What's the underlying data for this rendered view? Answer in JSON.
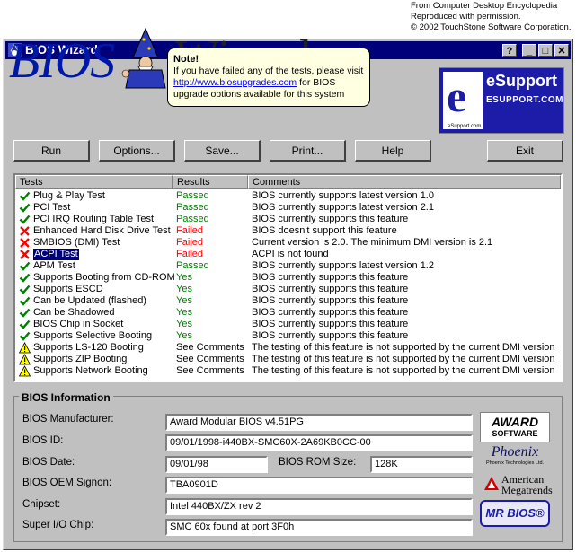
{
  "credit": {
    "line1": "From Computer Desktop Encyclopedia",
    "line2": "Reproduced with permission.",
    "line3": "© 2002 TouchStone Software Corporation."
  },
  "window": {
    "title": "BIOS Wizard",
    "help_btn": "?",
    "min_btn": "_",
    "max_btn": "□",
    "close_btn": "✕"
  },
  "banner": {
    "bios": "BIOS",
    "wizard": "Wizard"
  },
  "tooltip": {
    "note": "Note!",
    "line1": "If you have failed any of the tests, please visit",
    "link": "http://www.biosupgrades.com",
    "line2_rest": " for BIOS",
    "line3": "upgrade options available for this system"
  },
  "esupport": {
    "title": "eSupport",
    "sub": "ESUPPORT.COM",
    "small": "eSupport.com"
  },
  "buttons": {
    "run": "Run",
    "options": "Options...",
    "save": "Save...",
    "print": "Print...",
    "help": "Help",
    "exit": "Exit"
  },
  "table": {
    "headers": [
      "Tests",
      "Results",
      "Comments"
    ],
    "rows": [
      {
        "icon": "check",
        "test": "Plug & Play Test",
        "result": "Passed",
        "comment": "BIOS currently supports latest version 1.0"
      },
      {
        "icon": "check",
        "test": "PCI Test",
        "result": "Passed",
        "comment": "BIOS currently supports latest version 2.1"
      },
      {
        "icon": "check",
        "test": "PCI IRQ Routing Table Test",
        "result": "Passed",
        "comment": "BIOS currently supports this feature"
      },
      {
        "icon": "cross",
        "test": "Enhanced Hard Disk Drive Test",
        "result": "Failed",
        "comment": "BIOS doesn't support this feature"
      },
      {
        "icon": "cross",
        "test": "SMBIOS (DMI) Test",
        "result": "Failed",
        "comment": "Current version is 2.0. The minimum DMI version is 2.1"
      },
      {
        "icon": "cross",
        "test": "ACPI Test",
        "result": "Failed",
        "comment": "ACPI is not found"
      },
      {
        "icon": "check",
        "test": "APM Test",
        "result": "Passed",
        "comment": "BIOS currently supports latest version 1.2"
      },
      {
        "icon": "check",
        "test": "Supports Booting from CD-ROM",
        "result": "Yes",
        "comment": "BIOS currently supports this feature"
      },
      {
        "icon": "check",
        "test": "Supports ESCD",
        "result": "Yes",
        "comment": "BIOS currently supports this feature"
      },
      {
        "icon": "check",
        "test": "Can be Updated (flashed)",
        "result": "Yes",
        "comment": "BIOS currently supports this feature"
      },
      {
        "icon": "check",
        "test": "Can be Shadowed",
        "result": "Yes",
        "comment": "BIOS currently supports this feature"
      },
      {
        "icon": "check",
        "test": "BIOS Chip in Socket",
        "result": "Yes",
        "comment": "BIOS currently supports this feature"
      },
      {
        "icon": "check",
        "test": "Supports Selective Booting",
        "result": "Yes",
        "comment": "BIOS currently supports this feature"
      },
      {
        "icon": "warn",
        "test": "Supports LS-120 Booting",
        "result": "See Comments",
        "comment": "The testing of this feature is not supported by the current DMI version"
      },
      {
        "icon": "warn",
        "test": "Supports ZIP Booting",
        "result": "See Comments",
        "comment": "The testing of this feature is not supported by the current DMI version"
      },
      {
        "icon": "warn",
        "test": "Supports Network Booting",
        "result": "See Comments",
        "comment": "The testing of this feature is not supported by the current DMI version"
      }
    ]
  },
  "info": {
    "title": "BIOS Information",
    "manufacturer_label": "BIOS Manufacturer:",
    "manufacturer": "Award Modular BIOS v4.51PG",
    "id_label": "BIOS ID:",
    "id": "09/01/1998-i440BX-SMC60X-2A69KB0CC-00",
    "date_label": "BIOS Date:",
    "date": "09/01/98",
    "romsize_label": "BIOS ROM Size:",
    "romsize": "128K",
    "oem_label": "BIOS OEM Signon:",
    "oem": "TBA0901D",
    "chipset_label": "Chipset:",
    "chipset": "Intel 440BX/ZX rev 2",
    "superio_label": "Super I/O Chip:",
    "superio": "SMC 60x found at port 3F0h"
  },
  "badges": {
    "award1": "AWARD",
    "award2": "SOFTWARE",
    "phoenix1": "Phoenix",
    "phoenix2": "Phoenix Technologies Ltd.",
    "ami1": "American",
    "ami2": "Megatrends",
    "mrbios": "MR BIOS®"
  },
  "colors": {
    "pass": "#008000",
    "fail": "#ff0000",
    "titlebar": "#00007b"
  }
}
